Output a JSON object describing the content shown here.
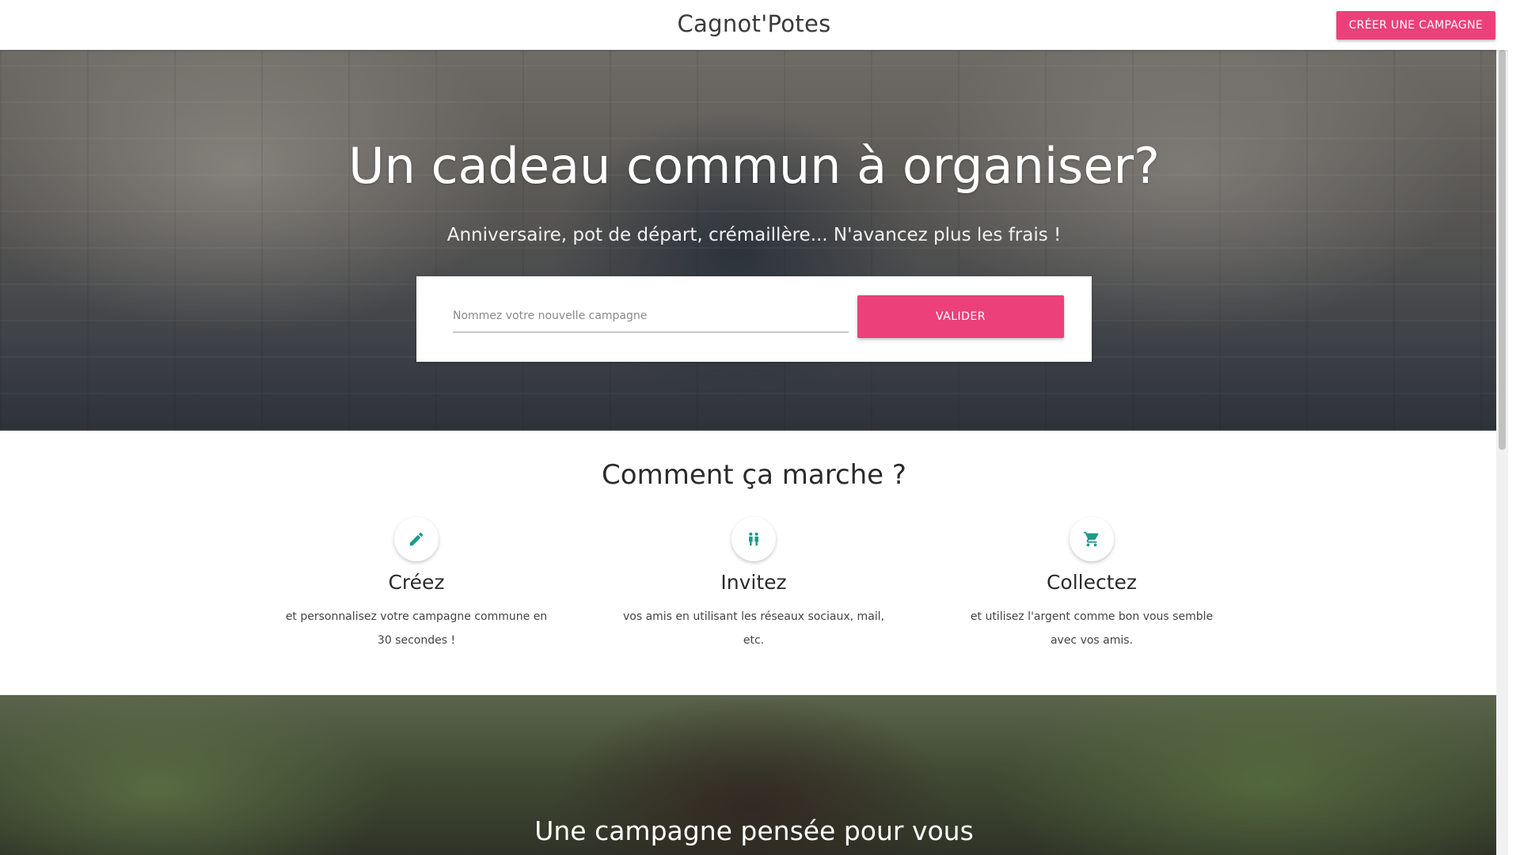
{
  "header": {
    "brand": "Cagnot'Potes",
    "create_button": "CRÉER UNE CAMPAGNE"
  },
  "hero": {
    "title": "Un cadeau commun à organiser?",
    "subtitle": "Anniversaire, pot de départ, crémaillère... N'avancez plus les frais !",
    "campaign_input": {
      "placeholder": "Nommez votre nouvelle campagne",
      "value": ""
    },
    "validate_button": "VALIDER"
  },
  "how": {
    "title": "Comment ça marche ?",
    "steps": [
      {
        "icon": "pencil-icon",
        "title": "Créez",
        "text": "et personnalisez votre campagne commune en 30 secondes !"
      },
      {
        "icon": "people-icon",
        "title": "Invitez",
        "text": "vos amis en utilisant les réseaux sociaux, mail, etc."
      },
      {
        "icon": "cart-icon",
        "title": "Collectez",
        "text": "et utilisez l'argent comme bon vous semble avec vos amis."
      }
    ]
  },
  "section2": {
    "title": "Une campagne pensée pour vous"
  },
  "colors": {
    "accent": "#ec407a",
    "icon": "#1b9a8a"
  }
}
